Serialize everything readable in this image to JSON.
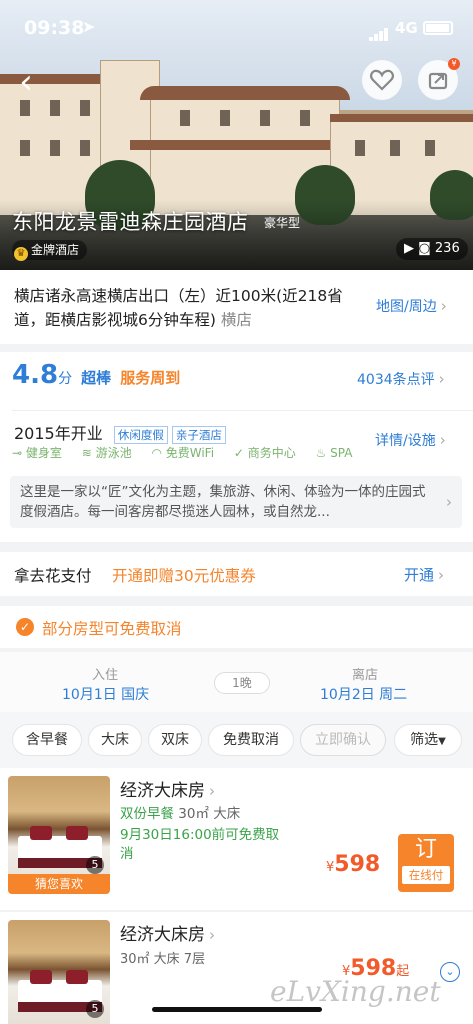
{
  "status_bar": {
    "time": "09:38",
    "network": "4G"
  },
  "hero": {
    "hotel_name": "东阳龙景雷迪森庄园酒店",
    "hotel_type": "豪华型",
    "level_badge": "金牌酒店",
    "media_count": "236"
  },
  "address": {
    "text": "横店诸永高速横店出口（左）近100米(近218省道，距横店影视城6分钟车程)",
    "district": "横店",
    "map_link": "地图/周边"
  },
  "rating": {
    "score": "4.8",
    "unit": "分",
    "grade": "超棒",
    "highlight": "服务周到",
    "review_count": "4034条点评"
  },
  "info": {
    "open_year": "2015年开业",
    "tags": [
      "休闲度假",
      "亲子酒店"
    ],
    "details_link": "详情/设施",
    "facilities": [
      "健身室",
      "游泳池",
      "免费WiFi",
      "商务中心",
      "SPA"
    ],
    "description": "这里是一家以“匠”文化为主题，集旅游、休闲、体验为一体的庄园式度假酒店。每一间客房都尽揽迷人园林，或自然龙..."
  },
  "payment": {
    "label": "拿去花支付",
    "promo": "开通即赠30元优惠券",
    "action": "开通"
  },
  "cancel_notice": "部分房型可免费取消",
  "dates": {
    "checkin_label": "入住",
    "checkin": "10月1日 国庆",
    "nights": "1晚",
    "checkout_label": "离店",
    "checkout": "10月2日 周二"
  },
  "filters": [
    "含早餐",
    "大床",
    "双床",
    "免费取消",
    "立即确认",
    "筛选"
  ],
  "rooms": [
    {
      "name": "经济大床房",
      "breakfast": "双份早餐",
      "area": "30㎡",
      "bed": "大床",
      "cancel_policy": "9月30日16:00前可免费取消",
      "price_symbol": "¥",
      "price": "598",
      "photo_count": "5",
      "label": "猜您喜欢",
      "book_label": "订",
      "book_sub": "在线付"
    },
    {
      "name": "经济大床房",
      "meta": "30㎡ 大床 7层",
      "price_symbol": "¥",
      "price": "598",
      "price_suffix": "起",
      "photo_count": "5"
    }
  ],
  "watermark": "eLvXing.net"
}
